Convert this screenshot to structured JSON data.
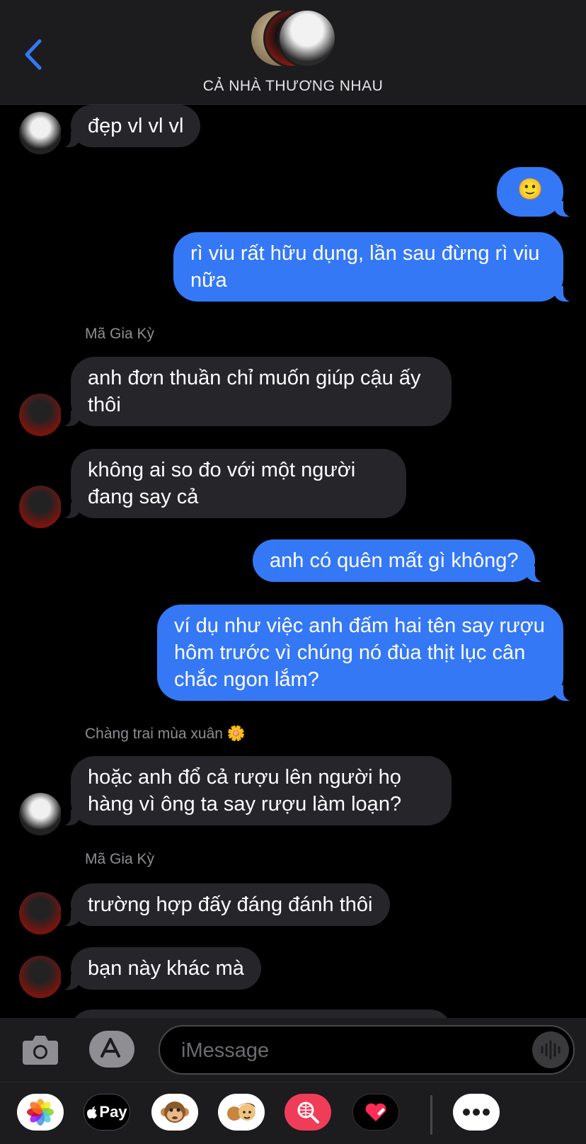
{
  "header": {
    "back_label": "Back",
    "group_title": "CẢ NHÀ THƯƠNG NHAU"
  },
  "messages": [
    {
      "dir": "in",
      "text": "đẹp vl vl vl"
    },
    {
      "dir": "out",
      "text": "🙂"
    },
    {
      "dir": "out",
      "text": "rì viu rất hữu dụng, lần sau đừng rì viu nữa"
    },
    {
      "sender": "Mã Gia Kỳ"
    },
    {
      "dir": "in",
      "text": "anh đơn thuần chỉ muốn giúp cậu ấy thôi"
    },
    {
      "dir": "in",
      "text": "không ai so đo với một người đang say cả"
    },
    {
      "dir": "out",
      "text": "anh có quên mất gì không?"
    },
    {
      "dir": "out",
      "text": "ví dụ như việc anh đấm hai tên say rượu hôm trước vì chúng nó đùa thịt lục cân chắc ngon lắm?"
    },
    {
      "sender": "Chàng trai mùa xuân 🌼"
    },
    {
      "dir": "in",
      "text": "hoặc anh đổ cả rượu lên người họ hàng vì ông ta say rượu làm loạn?"
    },
    {
      "sender": "Mã Gia Kỳ"
    },
    {
      "dir": "in",
      "text": "trường hợp đấy đáng đánh thôi"
    },
    {
      "dir": "in",
      "text": "bạn này khác mà"
    }
  ],
  "thread": {
    "m1": "đẹp vl vl vl",
    "m2": "🙂",
    "m3": "rì viu rất hữu dụng, lần sau đừng rì viu nữa",
    "s1": "Mã Gia Kỳ",
    "m4": "anh đơn thuần chỉ muốn giúp cậu ấy thôi",
    "m5": "không ai so đo với một người đang say cả",
    "m6": "anh có quên mất gì không?",
    "m7": "ví dụ như việc anh đấm hai tên say rượu hôm trước vì chúng nó đùa thịt lục cân chắc ngon lắm?",
    "s2": "Chàng trai mùa xuân 🌼",
    "m8": "hoặc anh đổ cả rượu lên người họ hàng vì ông ta say rượu làm loạn?",
    "s3": "Mã Gia Kỳ",
    "m9": "trường hợp đấy đáng đánh thôi",
    "m10": "bạn này khác mà"
  },
  "composer": {
    "placeholder": "iMessage",
    "value": ""
  },
  "apps": [
    {
      "name": "photos-app-icon"
    },
    {
      "name": "apple-pay-app-icon",
      "label": "Pay"
    },
    {
      "name": "animoji-app-icon"
    },
    {
      "name": "memoji-app-icon"
    },
    {
      "name": "image-search-app-icon"
    },
    {
      "name": "digital-touch-app-icon"
    },
    {
      "name": "more-apps-icon"
    }
  ],
  "colors": {
    "outgoing_bubble": "#3478f6",
    "incoming_bubble": "#26252a",
    "background": "#000000",
    "accent": "#3478f6"
  }
}
